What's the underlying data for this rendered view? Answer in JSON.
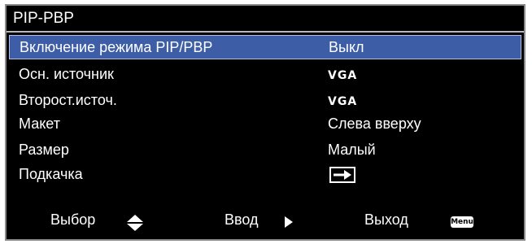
{
  "title": "PIP-PBP",
  "rows": [
    {
      "label": "Включение режима PIP/PBP",
      "value": "Выкл",
      "selected": true
    },
    {
      "label": "Осн. источник",
      "value": "VGA"
    },
    {
      "label": "Второст.источ.",
      "value": "VGA"
    },
    {
      "label": "Макет",
      "value": "Слева вверху"
    },
    {
      "label": "Размер",
      "value": "Малый"
    },
    {
      "label": "Подкачка",
      "value_icon": "swap-icon"
    }
  ],
  "footer": {
    "select_label": "Выбор",
    "select_icon": "up-down-icon",
    "enter_label": "Ввод",
    "enter_icon": "triangle-right-icon",
    "exit_label": "Выход",
    "exit_badge": "Menu"
  },
  "colors": {
    "background": "#000000",
    "selected_row": "#3d5ea6",
    "text": "#ffffff",
    "border": "#8a8a8a"
  }
}
